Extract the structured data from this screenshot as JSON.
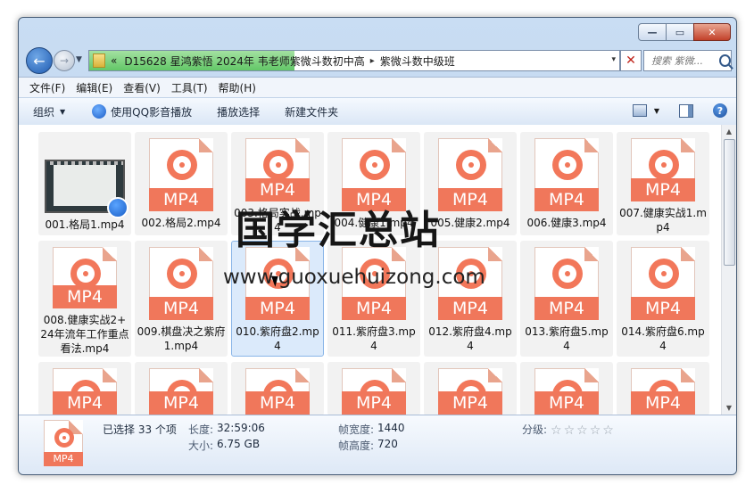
{
  "window": {
    "caption_buttons": {
      "minimize": "—",
      "maximize": "▭",
      "close": "✕"
    }
  },
  "address": {
    "history_chevron": "«",
    "crumbs": [
      "D15628 星鸿紫悟 2024年 韦老师紫微斗数初中高",
      "紫微斗数中级班"
    ],
    "separator": "▸",
    "dropdown": "▾",
    "clear": "✕"
  },
  "search": {
    "placeholder": "搜索 紫微..."
  },
  "menu": [
    "文件(F)",
    "编辑(E)",
    "查看(V)",
    "工具(T)",
    "帮助(H)"
  ],
  "toolbar": {
    "organize": "组织",
    "play_qq": "使用QQ影音播放",
    "play_selection": "播放选择",
    "new_folder": "新建文件夹",
    "help": "?"
  },
  "file_badge": "MP4",
  "files_row1": [
    {
      "name": "001.格局1.mp4",
      "thumb": true
    },
    {
      "name": "002.格局2.mp4"
    },
    {
      "name": "003.格局实战.mp4"
    },
    {
      "name": "004.健康1.mp4"
    },
    {
      "name": "005.健康2.mp4"
    },
    {
      "name": "006.健康3.mp4"
    },
    {
      "name": "007.健康实战1.mp4"
    }
  ],
  "files_row2": [
    {
      "name": "008.健康实战2+24年流年工作重点看法.mp4"
    },
    {
      "name": "009.棋盘决之紫府1.mp4"
    },
    {
      "name": "010.紫府盘2.mp4",
      "selected": true
    },
    {
      "name": "011.紫府盘3.mp4"
    },
    {
      "name": "012.紫府盘4.mp4"
    },
    {
      "name": "013.紫府盘5.mp4"
    },
    {
      "name": "014.紫府盘6.mp4"
    }
  ],
  "details": {
    "selected_count": "已选择 33 个项",
    "length_label": "长度:",
    "length_value": "32:59:06",
    "size_label": "大小:",
    "size_value": "6.75 GB",
    "width_label": "帧宽度:",
    "width_value": "1440",
    "height_label": "帧高度:",
    "height_value": "720",
    "rating_label": "分级:",
    "rating": 0
  },
  "watermark": {
    "text": "国学汇总站",
    "url": "www.guoxuehuizong.com"
  }
}
